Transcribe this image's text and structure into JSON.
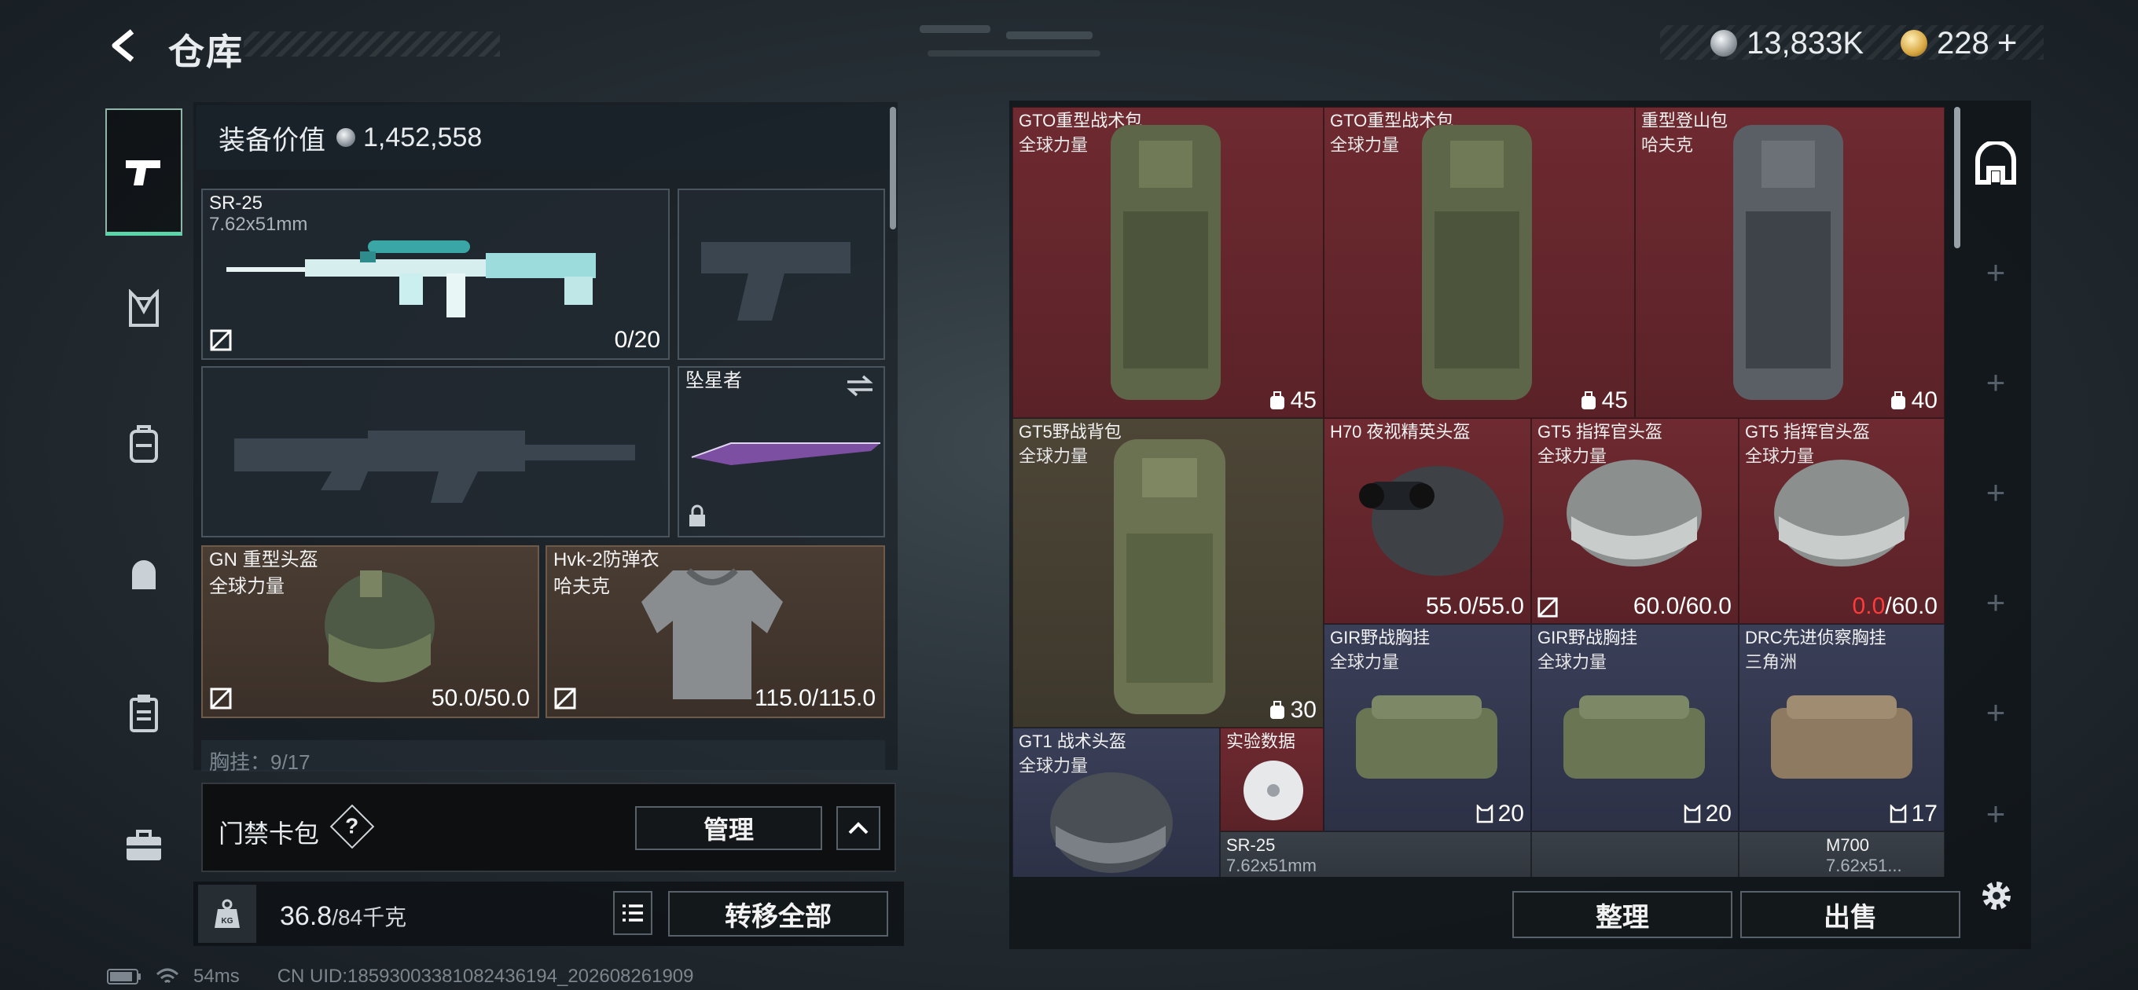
{
  "header": {
    "title": "仓库",
    "silver_amount": "13,833K",
    "gold_amount": "228",
    "add_symbol": "+"
  },
  "equipment": {
    "value_label": "装备价值",
    "value_amount": "1,452,558",
    "primary": {
      "name": "SR-25",
      "caliber": "7.62x51mm",
      "ammo": "0/20"
    },
    "melee": {
      "name": "坠星者"
    },
    "helmet": {
      "name": "GN 重型头盔",
      "faction": "全球力量",
      "durability": "50.0/50.0"
    },
    "armor": {
      "name": "Hvk-2防弹衣",
      "faction": "哈夫克",
      "durability": "115.0/115.0"
    },
    "partial_label": "胸挂：9/17"
  },
  "card_pack": {
    "label": "门禁卡包",
    "help": "?",
    "manage_label": "管理"
  },
  "capacity": {
    "current": "36.8",
    "max": "/84千克",
    "weight_icon": "KG"
  },
  "actions": {
    "transfer_all": "转移全部",
    "sort": "整理",
    "sell": "出售"
  },
  "items": [
    {
      "name": "GTO重型战术包",
      "faction": "全球力量",
      "count": "45"
    },
    {
      "name": "GTO重型战术包",
      "faction": "全球力量",
      "count": "45"
    },
    {
      "name": "重型登山包",
      "faction": "哈夫克",
      "count": "40"
    },
    {
      "name": "GT5野战背包",
      "faction": "全球力量",
      "count": "30"
    },
    {
      "name": "H70 夜视精英头盔",
      "faction": "",
      "durability": "55.0/55.0"
    },
    {
      "name": "GT5 指挥官头盔",
      "faction": "全球力量",
      "durability": "60.0/60.0"
    },
    {
      "name": "GT5 指挥官头盔",
      "faction": "全球力量",
      "durability_current": "0.0",
      "durability_max": "/60.0"
    },
    {
      "name": "GIR野战胸挂",
      "faction": "全球力量",
      "count": "20"
    },
    {
      "name": "GIR野战胸挂",
      "faction": "全球力量",
      "count": "20"
    },
    {
      "name": "DRC先进侦察胸挂",
      "faction": "三角洲",
      "count": "17"
    },
    {
      "name": "GT1 战术头盔",
      "faction": "全球力量"
    },
    {
      "name": "实验数据"
    },
    {
      "name": "SR-25",
      "caliber": "7.62x51mm"
    },
    {
      "name": "M700",
      "caliber": "7.62x51..."
    }
  ],
  "status": {
    "ping": "54ms",
    "uid": "CN UID:18593003381082436194_202608261909"
  },
  "colors": {
    "accent_green": "#5ad6a8",
    "red_tier": "#6e2a30",
    "olive_tier": "#4d4637",
    "navy_tier": "#3a3f58",
    "warning_red": "#ff3a3a"
  }
}
